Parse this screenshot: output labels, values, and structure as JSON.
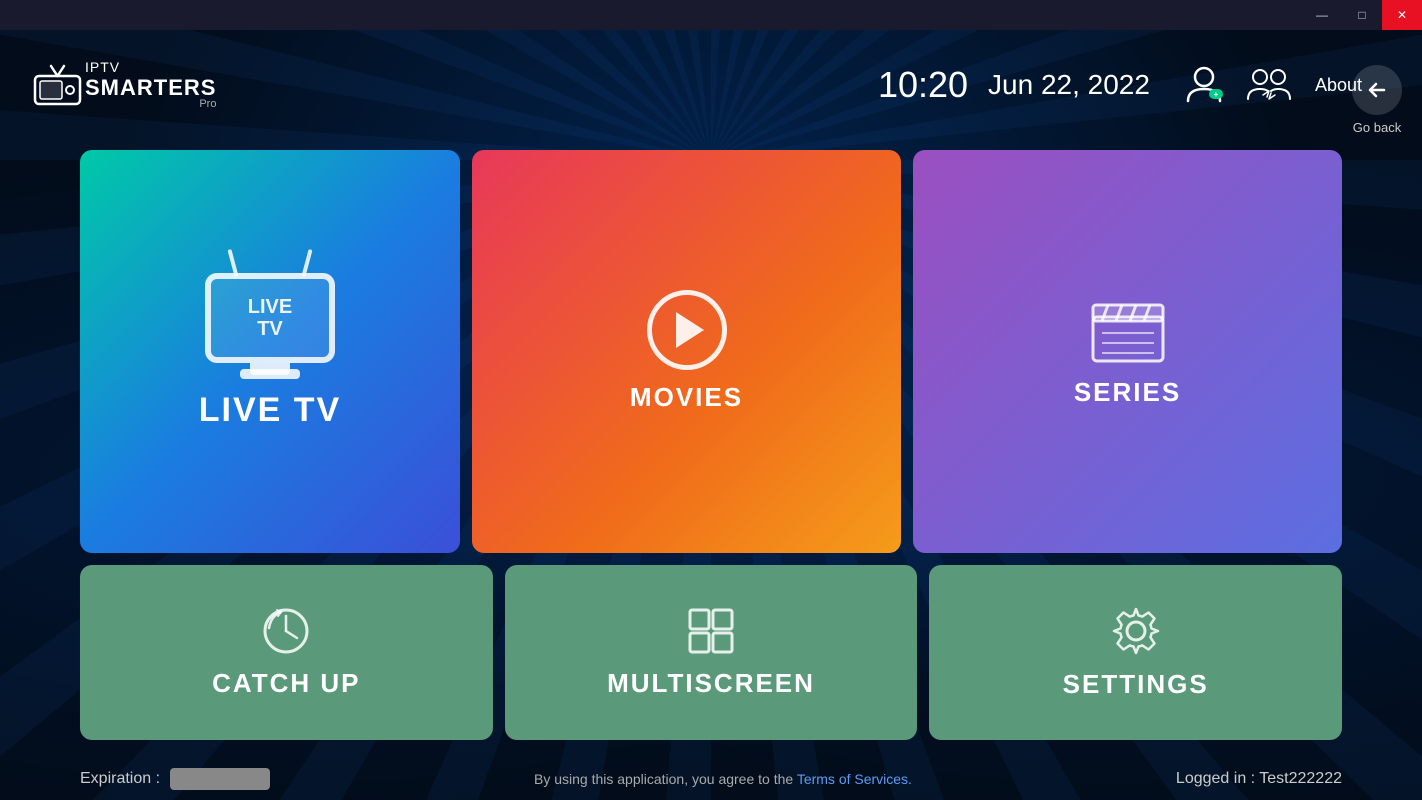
{
  "titlebar": {
    "minimize_label": "—",
    "maximize_label": "□",
    "close_label": "✕"
  },
  "header": {
    "logo_iptv": "IPTV",
    "logo_smarters": "SMARTERS",
    "logo_pro": "Pro",
    "time": "10:20",
    "date": "Jun 22, 2022",
    "about_label": "About",
    "go_back_label": "Go back"
  },
  "cards": {
    "live_tv": {
      "label": "LIVE TV",
      "inner_label_line1": "LIVE",
      "inner_label_line2": "TV"
    },
    "movies": {
      "label": "MOVIES"
    },
    "series": {
      "label": "SERIES"
    },
    "catchup": {
      "label": "CATCH UP"
    },
    "multiscreen": {
      "label": "MULTISCREEN"
    },
    "settings": {
      "label": "SETTINGS"
    }
  },
  "footer": {
    "expiration_label": "Expiration :",
    "terms_text": "By using this application, you agree to the",
    "terms_link": "Terms of Services.",
    "logged_in": "Logged in : Test222222"
  }
}
